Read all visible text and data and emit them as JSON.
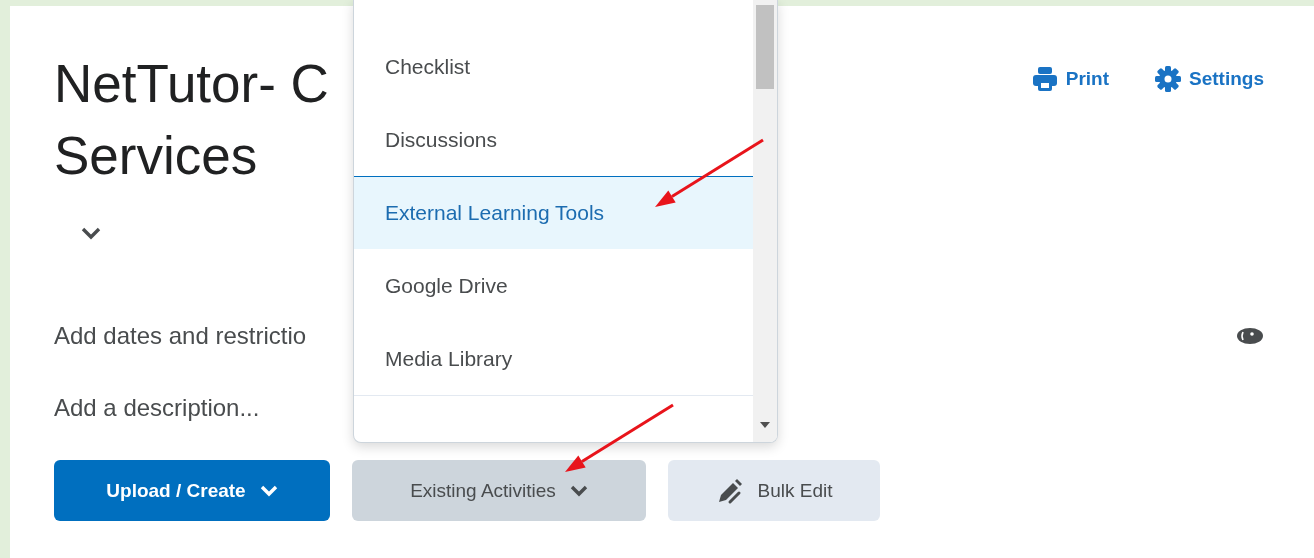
{
  "header": {
    "title_lines": [
      "NetTutor- C",
      "Services"
    ],
    "actions": [
      {
        "label": "Print",
        "kind": "print"
      },
      {
        "label": "Settings",
        "kind": "settings"
      }
    ]
  },
  "dates_link": "Add dates and restrictio",
  "description_placeholder": "Add a description...",
  "buttons": [
    {
      "label": "Upload / Create",
      "kind": "primary",
      "caret": true
    },
    {
      "label": "Existing Activities",
      "kind": "secondary",
      "caret": true
    },
    {
      "label": "Bulk Edit",
      "kind": "tertiary",
      "caret": false
    }
  ],
  "menu": {
    "items": [
      {
        "label": "Checklist",
        "selected": false
      },
      {
        "label": "Discussions",
        "selected": false
      },
      {
        "label": "External Learning Tools",
        "selected": true
      },
      {
        "label": "Google Drive",
        "selected": false
      },
      {
        "label": "Media Library",
        "selected": false
      }
    ]
  }
}
